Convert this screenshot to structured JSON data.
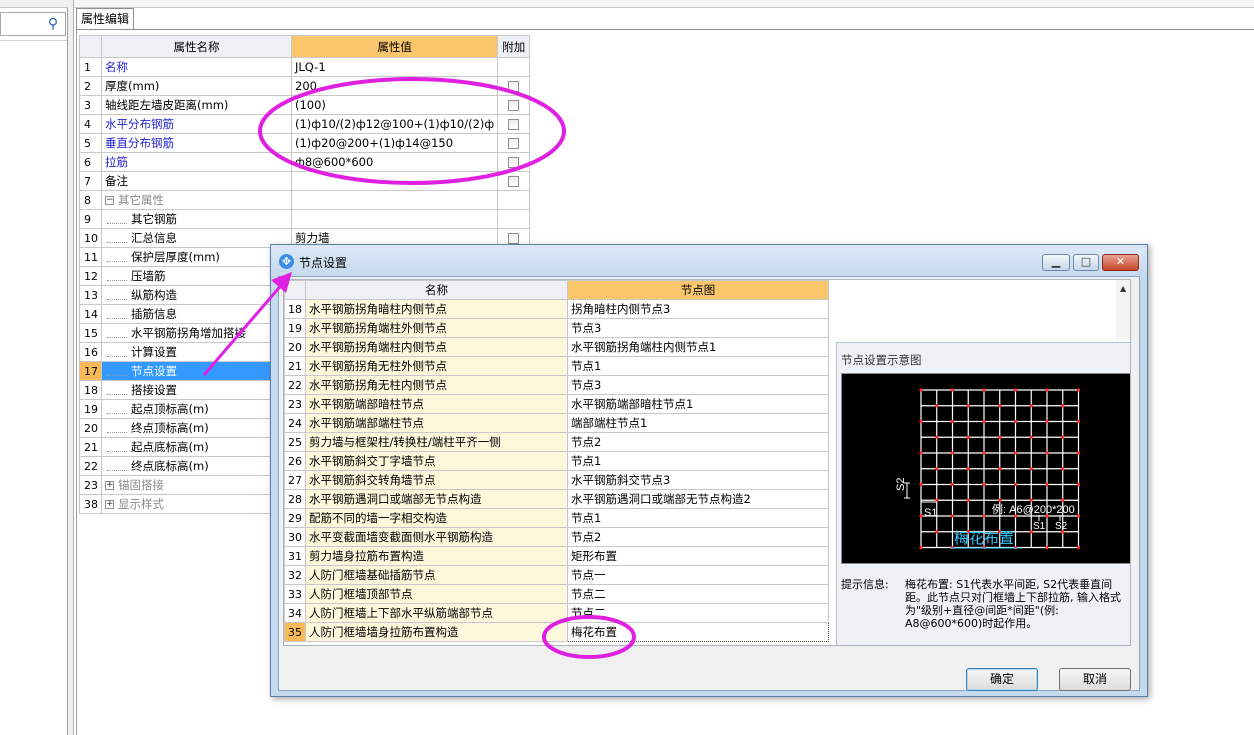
{
  "colors": {
    "accent_header": "#f9c66b",
    "selected_row": "#3399ff",
    "selected_num": "#f8b956",
    "annotation": "#e020e0",
    "link_text": "#1f1fd0"
  },
  "property_editor": {
    "tab_label": "属性编辑",
    "headers": {
      "name": "属性名称",
      "value": "属性值",
      "extra": "附加"
    },
    "rows": [
      {
        "num": "1",
        "name": "名称",
        "value": "JLQ-1",
        "style": "blue",
        "checkbox": false
      },
      {
        "num": "2",
        "name": "厚度(mm)",
        "value": "200",
        "style": "",
        "checkbox": true
      },
      {
        "num": "3",
        "name": "轴线距左墙皮距离(mm)",
        "value": "(100)",
        "style": "",
        "checkbox": true
      },
      {
        "num": "4",
        "name": "水平分布钢筋",
        "value": "(1)ф10/(2)ф12@100+(1)ф10/(2)ф",
        "style": "blue",
        "checkbox": true
      },
      {
        "num": "5",
        "name": "垂直分布钢筋",
        "value": "(1)ф20@200+(1)ф14@150",
        "style": "blue",
        "checkbox": true
      },
      {
        "num": "6",
        "name": "拉筋",
        "value": "ф8@600*600",
        "style": "blue",
        "checkbox": true
      },
      {
        "num": "7",
        "name": "备注",
        "value": "",
        "style": "",
        "checkbox": true
      },
      {
        "num": "8",
        "name": "其它属性",
        "value": "",
        "style": "grey",
        "expander": "−",
        "checkbox": false
      },
      {
        "num": "9",
        "name": "其它钢筋",
        "value": "",
        "style": "indent",
        "checkbox": false
      },
      {
        "num": "10",
        "name": "汇总信息",
        "value": "剪力墙",
        "style": "indent",
        "checkbox": true
      },
      {
        "num": "11",
        "name": "保护层厚度(mm)",
        "value": "",
        "style": "indent",
        "checkbox": false
      },
      {
        "num": "12",
        "name": "压墙筋",
        "value": "",
        "style": "indent",
        "checkbox": false
      },
      {
        "num": "13",
        "name": "纵筋构造",
        "value": "",
        "style": "indent",
        "checkbox": false
      },
      {
        "num": "14",
        "name": "插筋信息",
        "value": "",
        "style": "indent",
        "checkbox": false
      },
      {
        "num": "15",
        "name": "水平钢筋拐角增加搭接",
        "value": "",
        "style": "indent",
        "checkbox": false
      },
      {
        "num": "16",
        "name": "计算设置",
        "value": "",
        "style": "indent",
        "checkbox": false
      },
      {
        "num": "17",
        "name": "节点设置",
        "value": "",
        "style": "indent",
        "selected": true,
        "checkbox": false
      },
      {
        "num": "18",
        "name": "搭接设置",
        "value": "",
        "style": "indent",
        "checkbox": false
      },
      {
        "num": "19",
        "name": "起点顶标高(m)",
        "value": "",
        "style": "indent",
        "checkbox": false
      },
      {
        "num": "20",
        "name": "终点顶标高(m)",
        "value": "",
        "style": "indent",
        "checkbox": false
      },
      {
        "num": "21",
        "name": "起点底标高(m)",
        "value": "",
        "style": "indent",
        "checkbox": false
      },
      {
        "num": "22",
        "name": "终点底标高(m)",
        "value": "",
        "style": "indent",
        "checkbox": false
      },
      {
        "num": "23",
        "name": "锚固搭接",
        "value": "",
        "style": "grey",
        "expander": "+",
        "checkbox": false
      },
      {
        "num": "38",
        "name": "显示样式",
        "value": "",
        "style": "grey",
        "expander": "+",
        "checkbox": false
      }
    ]
  },
  "dialog": {
    "title": "节点设置",
    "min_glyph": "▁",
    "max_glyph": "□",
    "close_glyph": "✕",
    "headers": {
      "name": "名称",
      "value": "节点图"
    },
    "rows": [
      {
        "num": "18",
        "name": "水平钢筋拐角暗柱内侧节点",
        "value": "拐角暗柱内侧节点3"
      },
      {
        "num": "19",
        "name": "水平钢筋拐角端柱外侧节点",
        "value": "节点3"
      },
      {
        "num": "20",
        "name": "水平钢筋拐角端柱内侧节点",
        "value": "水平钢筋拐角端柱内侧节点1"
      },
      {
        "num": "21",
        "name": "水平钢筋拐角无柱外侧节点",
        "value": "节点1"
      },
      {
        "num": "22",
        "name": "水平钢筋拐角无柱内侧节点",
        "value": "节点3"
      },
      {
        "num": "23",
        "name": "水平钢筋端部暗柱节点",
        "value": "水平钢筋端部暗柱节点1"
      },
      {
        "num": "24",
        "name": "水平钢筋端部端柱节点",
        "value": "端部端柱节点1"
      },
      {
        "num": "25",
        "name": "剪力墙与框架柱/转换柱/端柱平齐一侧",
        "value": "节点2"
      },
      {
        "num": "26",
        "name": "水平钢筋斜交丁字墙节点",
        "value": "节点1"
      },
      {
        "num": "27",
        "name": "水平钢筋斜交转角墙节点",
        "value": "水平钢筋斜交节点3"
      },
      {
        "num": "28",
        "name": "水平钢筋遇洞口或端部无节点构造",
        "value": "水平钢筋遇洞口或端部无节点构造2"
      },
      {
        "num": "29",
        "name": "配筋不同的墙一字相交构造",
        "value": "节点1"
      },
      {
        "num": "30",
        "name": "水平变截面墙变截面侧水平钢筋构造",
        "value": "节点2"
      },
      {
        "num": "31",
        "name": "剪力墙身拉筋布置构造",
        "value": "矩形布置"
      },
      {
        "num": "32",
        "name": "人防门框墙基础插筋节点",
        "value": "节点一"
      },
      {
        "num": "33",
        "name": "人防门框墙顶部节点",
        "value": "节点二"
      },
      {
        "num": "34",
        "name": "人防门框墙上下部水平纵筋端部节点",
        "value": "节点二"
      },
      {
        "num": "35",
        "name": "人防门框墙墙身拉筋布置构造",
        "value": "梅花布置"
      }
    ],
    "preview": {
      "label": "节点设置示意图",
      "diagram_caption": "梅花布置",
      "example_text": "例: A6@200*200",
      "s1": "S1",
      "s2": "S2",
      "info_key": "提示信息:",
      "info_text": "梅花布置: S1代表水平间距, S2代表垂直间距。此节点只对门框墙上下部拉筋, 输入格式为\"级别+直径@间距*间距\"(例: A8@600*600)时起作用。"
    },
    "ok_label": "确定",
    "cancel_label": "取消"
  }
}
